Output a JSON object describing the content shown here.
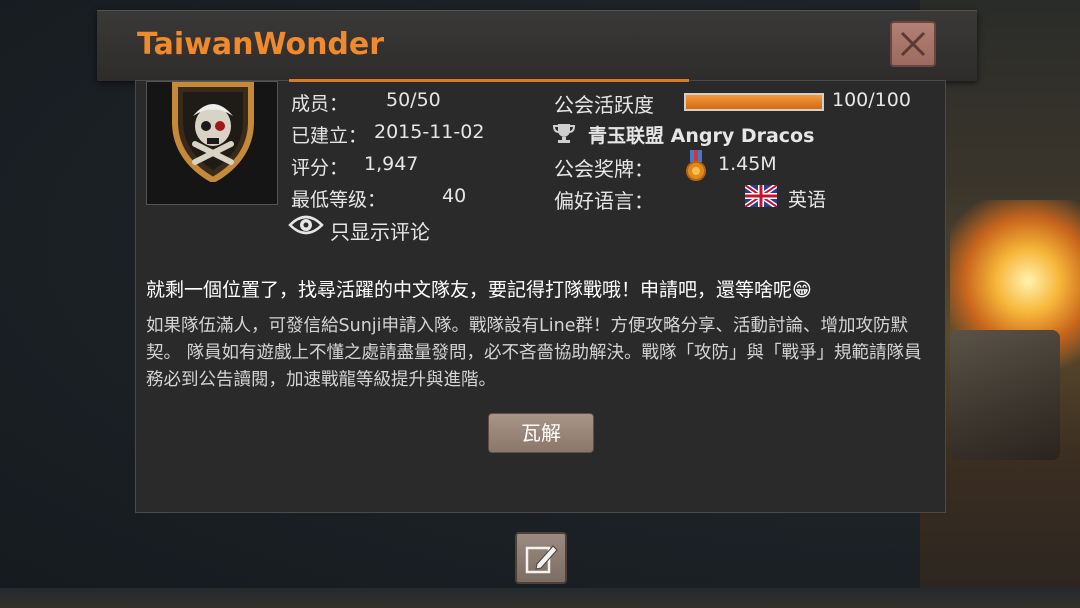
{
  "guild": {
    "name": "TaiwanWonder",
    "members_label": "成员：",
    "members_value": "50/50",
    "founded_label": "已建立：",
    "founded_value": "2015-11-02",
    "rating_label": "评分：",
    "rating_value": "1,947",
    "min_level_label": "最低等级：",
    "min_level_value": "40",
    "view_comments_label": "只显示评论",
    "activity_label": "公会活跃度",
    "activity_value": "100/100",
    "activity_fraction": 1.0,
    "alliance_label": "青玉联盟 Angry Dracos",
    "medals_label": "公会奖牌：",
    "medals_value": "1.45M",
    "language_label": "偏好语言：",
    "language_value": "英语",
    "tagline": "就剩一個位置了，找尋活躍的中文隊友，要記得打隊戰哦！申請吧，還等啥呢😁",
    "description": "如果隊伍滿人，可發信給Sunji申請入隊。戰隊設有Line群！方便攻略分享、活動討論、增加攻防默契。 隊員如有遊戲上不懂之處請盡量發問，必不吝嗇協助解決。戰隊「攻防」與「戰爭」規範請隊員務必到公告讀閱，加速戰龍等級提升與進階。",
    "disband_label": "瓦解"
  },
  "icons": {
    "close": "close-x-icon",
    "eye": "eye-icon",
    "trophy": "trophy-icon",
    "medal": "medal-icon",
    "flag": "uk-flag-icon",
    "edit": "edit-pencil-icon",
    "emblem": "skull-shield-emblem"
  },
  "colors": {
    "title": "#f08a2c",
    "activity_bar": "#e07a1f",
    "close_button": "#a9766b",
    "action_button": "#9a877a"
  }
}
